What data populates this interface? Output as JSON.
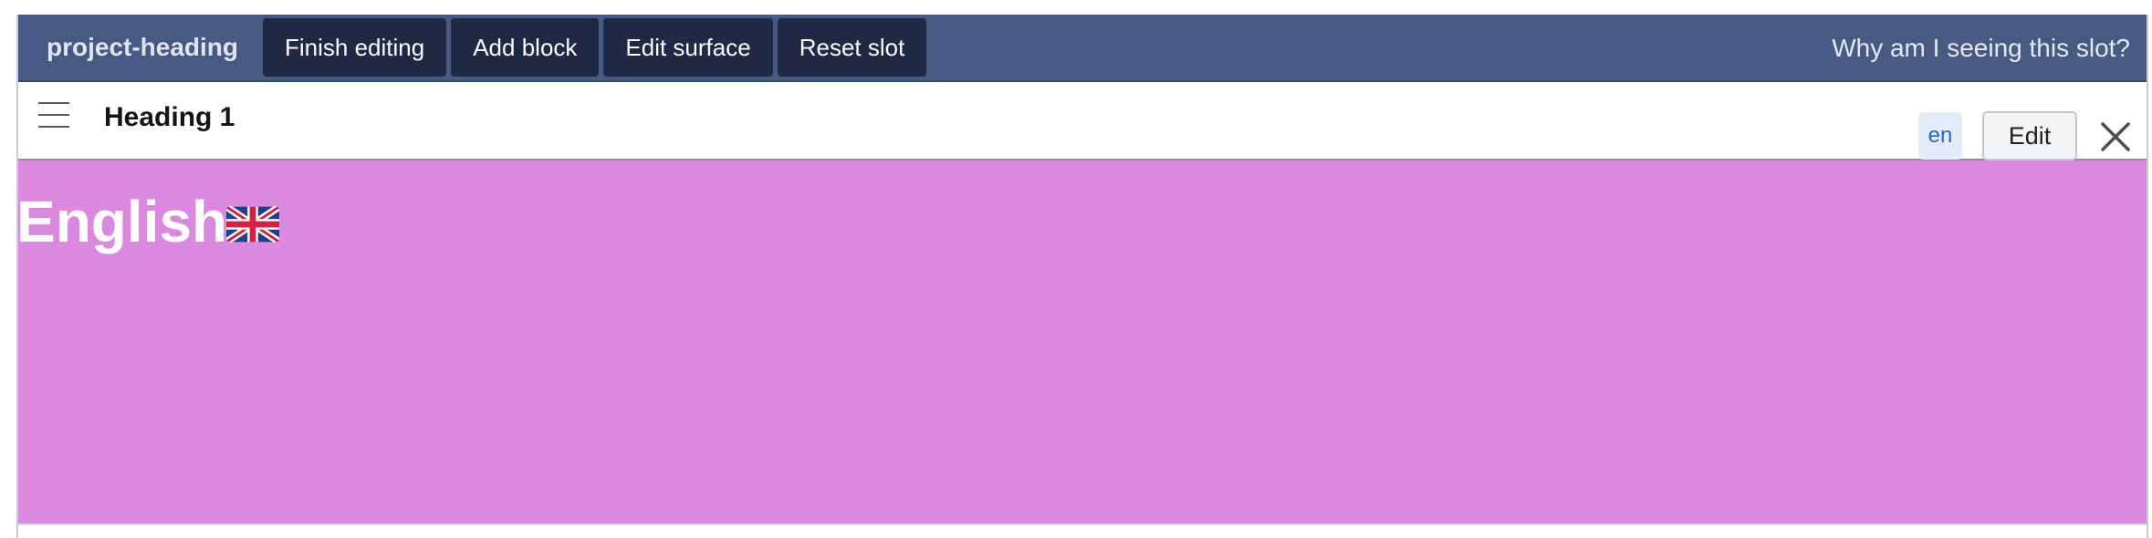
{
  "toolbar": {
    "slot_name": "project-heading",
    "buttons": [
      {
        "label": "Finish editing"
      },
      {
        "label": "Add block"
      },
      {
        "label": "Edit surface"
      },
      {
        "label": "Reset slot"
      }
    ],
    "why_link": "Why am I seeing this slot?"
  },
  "block": {
    "title": "Heading 1",
    "language": "en",
    "edit_label": "Edit",
    "drag_icon": "hamburger-icon",
    "close_icon": "close-icon"
  },
  "content": {
    "heading": "English",
    "flag_icon": "uk-flag-icon",
    "background_color": "#db88e0"
  },
  "colors": {
    "toolbar_bg": "#475a84",
    "toolbar_button_bg": "#1f2845",
    "lang_badge_bg": "#e3ecfb",
    "lang_badge_text": "#2b66c4"
  }
}
